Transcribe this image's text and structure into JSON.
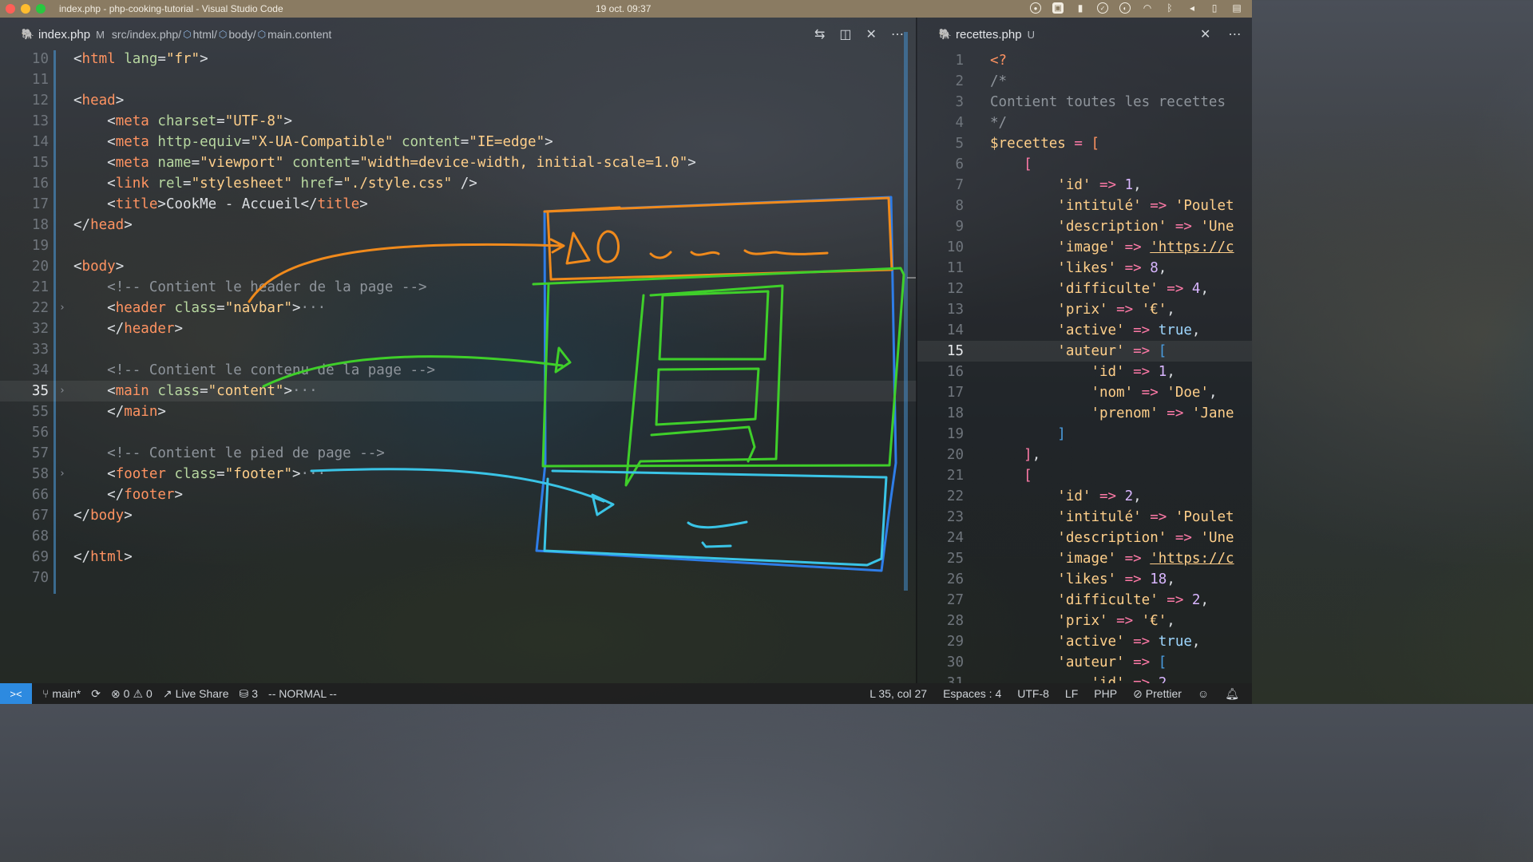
{
  "menubar": {
    "window_title": "index.php - php-cooking-tutorial - Visual Studio Code",
    "datetime": "19 oct.  09:37"
  },
  "left_editor": {
    "tab": {
      "filename": "index.php",
      "status": "M"
    },
    "breadcrumb": [
      "src/index.php/",
      "html/",
      "body/",
      "main.content"
    ],
    "current_line": "35"
  },
  "right_editor": {
    "tab": {
      "filename": "recettes.php",
      "status": "U"
    },
    "current_line": "15"
  },
  "statusbar": {
    "branch": "main*",
    "errors": "0",
    "warnings": "0",
    "live_share": "Live Share",
    "db_count": "3",
    "mode": "-- NORMAL --",
    "position": "L 35, col 27",
    "spaces": "Espaces : 4",
    "encoding": "UTF-8",
    "eol": "LF",
    "language": "PHP",
    "formatter": "Prettier"
  },
  "sketch_colors": {
    "header": "#f08a1c",
    "main": "#3fcf2a",
    "footer": "#3ac4e6",
    "page": "#2e7de8"
  }
}
